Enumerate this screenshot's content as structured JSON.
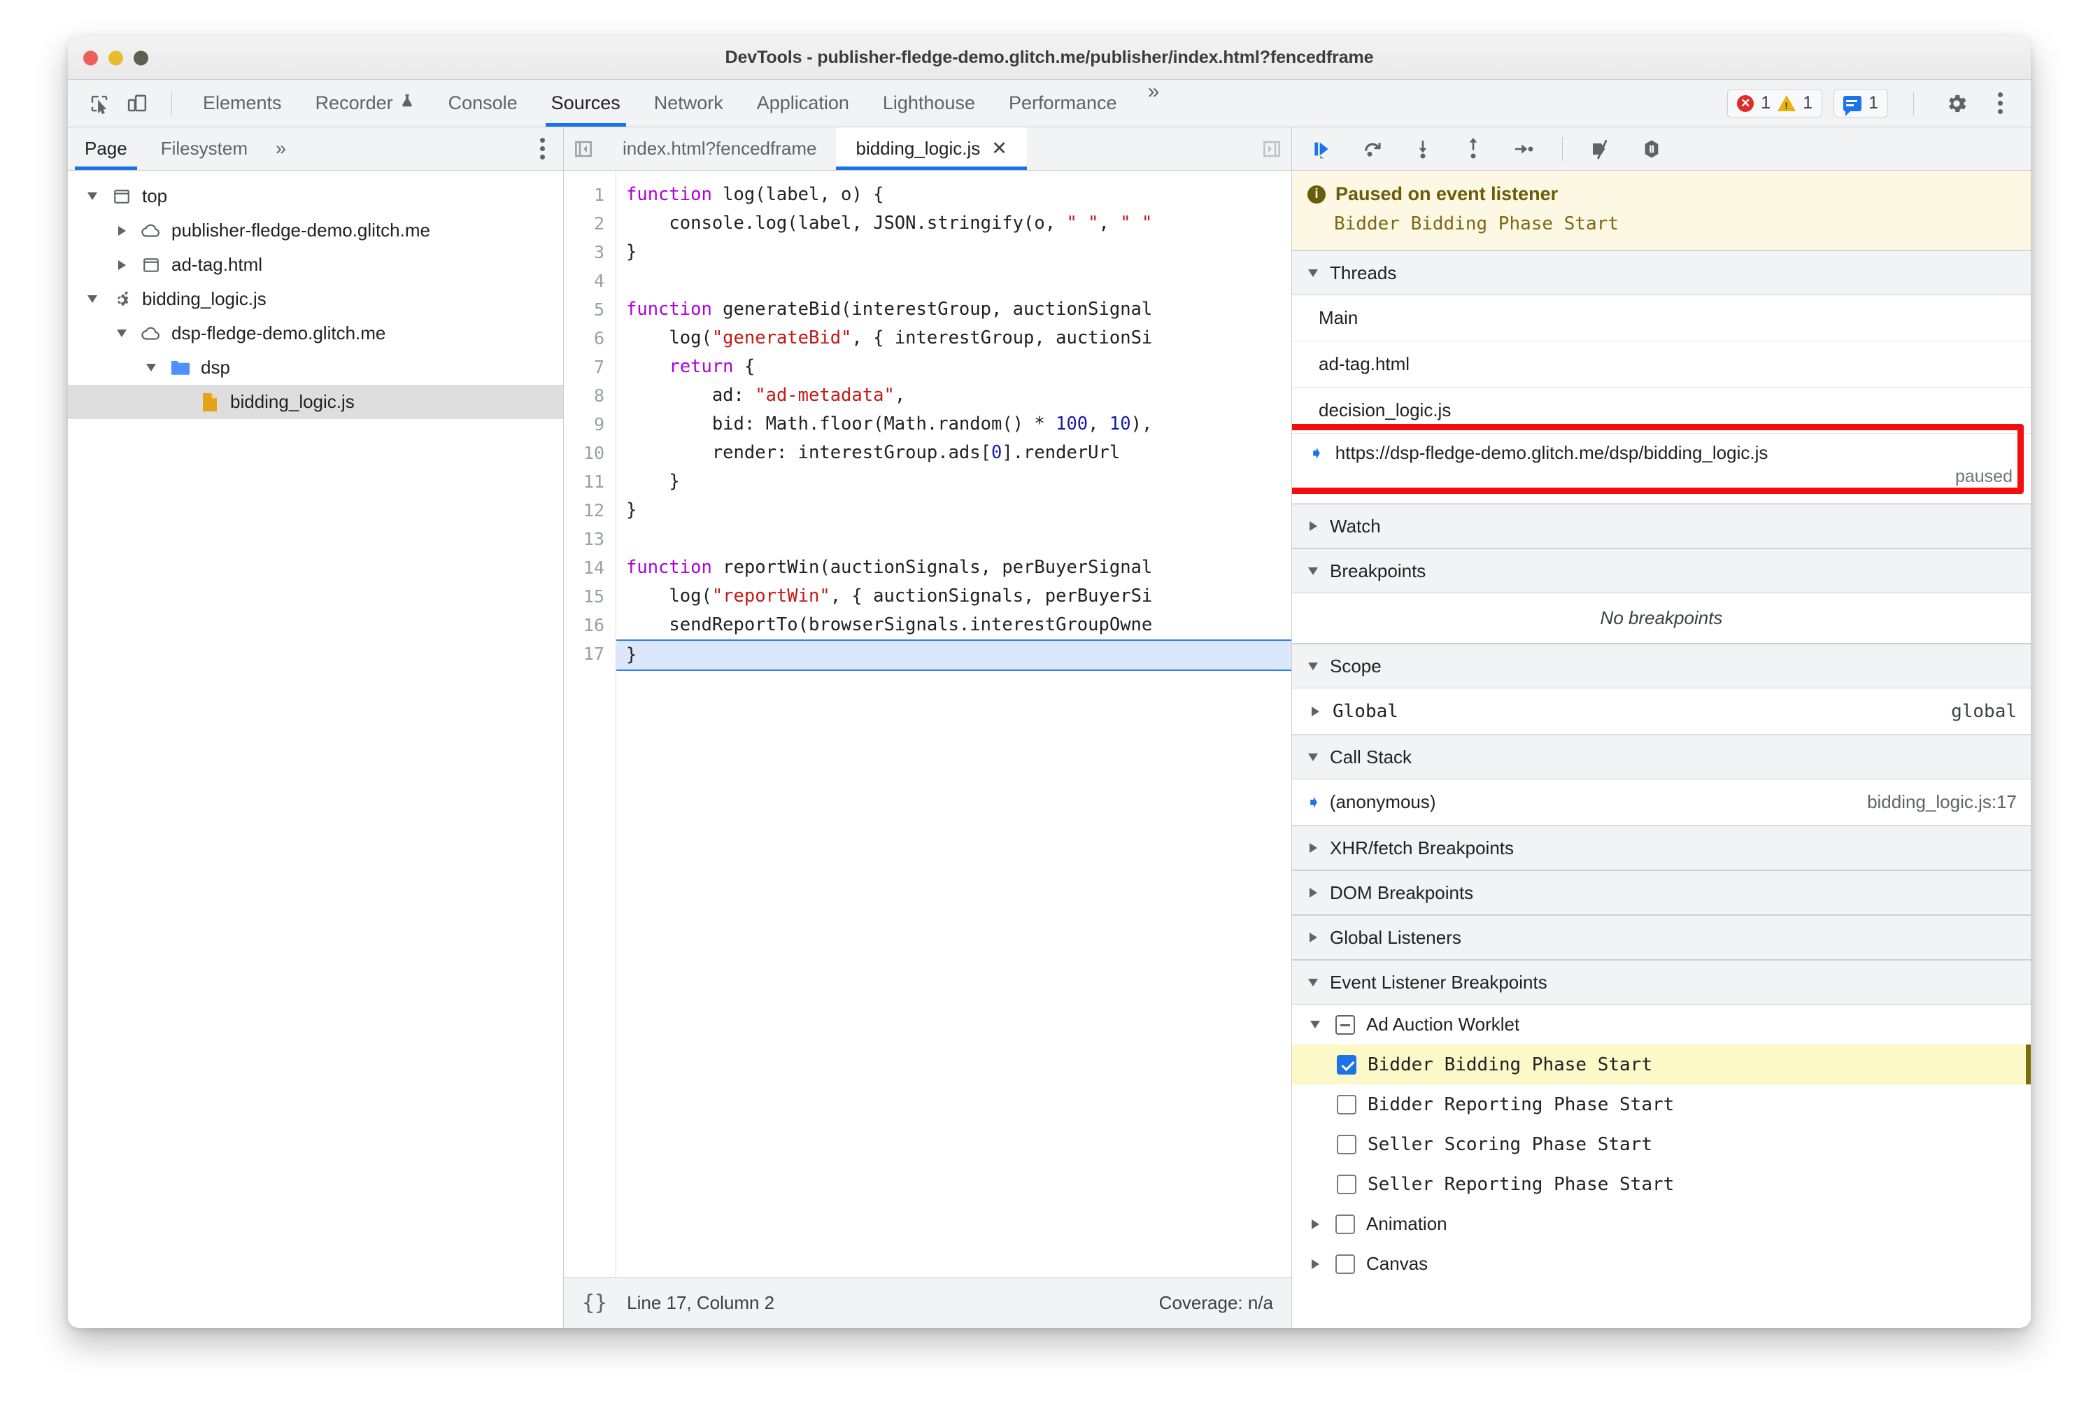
{
  "window": {
    "title": "DevTools - publisher-fledge-demo.glitch.me/publisher/index.html?fencedframe",
    "traffic_lights": [
      "close",
      "minimize",
      "zoom"
    ]
  },
  "toolbar": {
    "icons": [
      "inspect-element-icon",
      "device-toolbar-icon"
    ],
    "tabs": [
      {
        "label": "Elements",
        "active": false
      },
      {
        "label": "Recorder",
        "active": false,
        "badge_icon": "experiment-flask-icon"
      },
      {
        "label": "Console",
        "active": false
      },
      {
        "label": "Sources",
        "active": true
      },
      {
        "label": "Network",
        "active": false
      },
      {
        "label": "Application",
        "active": false
      },
      {
        "label": "Lighthouse",
        "active": false
      },
      {
        "label": "Performance",
        "active": false
      }
    ],
    "more_tabs": "»",
    "error_count": "1",
    "warning_count": "1",
    "message_count": "1",
    "settings_icon": "gear-icon",
    "overflow_icon": "kebab-menu-icon",
    "accent_color": "#1a73e8",
    "error_color": "#dd2c2c",
    "warning_color": "#e9b213"
  },
  "navigator": {
    "tabs": [
      {
        "label": "Page",
        "active": true
      },
      {
        "label": "Filesystem",
        "active": false
      }
    ],
    "more": "»",
    "tree": [
      {
        "label": "top",
        "indent": 0,
        "twisty": "down",
        "icon": "frame-icon",
        "selected": false
      },
      {
        "label": "publisher-fledge-demo.glitch.me",
        "indent": 1,
        "twisty": "right",
        "icon": "cloud-icon",
        "selected": false
      },
      {
        "label": "ad-tag.html",
        "indent": 1,
        "twisty": "right",
        "icon": "frame-icon",
        "selected": false
      },
      {
        "label": "bidding_logic.js",
        "indent": 0,
        "twisty": "down",
        "icon": "worklet-gears-icon",
        "selected": false
      },
      {
        "label": "dsp-fledge-demo.glitch.me",
        "indent": 1,
        "twisty": "down",
        "icon": "cloud-icon",
        "selected": false
      },
      {
        "label": "dsp",
        "indent": 2,
        "twisty": "down",
        "icon": "folder-icon",
        "selected": false
      },
      {
        "label": "bidding_logic.js",
        "indent": 3,
        "twisty": "none",
        "icon": "js-file-icon",
        "selected": true
      }
    ]
  },
  "editor": {
    "tabs": [
      {
        "label": "index.html?fencedframe",
        "active": false,
        "closable": false
      },
      {
        "label": "bidding_logic.js",
        "active": true,
        "closable": true,
        "close_glyph": "✕"
      }
    ],
    "nav_prev_icon": "tab-scroll-left-icon",
    "nav_next_icon": "tab-scroll-right-icon",
    "lines": [
      {
        "n": "1",
        "current": false,
        "tokens": [
          {
            "t": "function ",
            "c": "kw"
          },
          {
            "t": "log(label, o) {",
            "c": ""
          }
        ]
      },
      {
        "n": "2",
        "current": false,
        "tokens": [
          {
            "t": "    console.log(label, JSON.stringify(o, ",
            "c": ""
          },
          {
            "t": "\" \"",
            "c": "str"
          },
          {
            "t": ", ",
            "c": ""
          },
          {
            "t": "\" \"",
            "c": "str"
          }
        ]
      },
      {
        "n": "3",
        "current": false,
        "tokens": [
          {
            "t": "}",
            "c": ""
          }
        ]
      },
      {
        "n": "4",
        "current": false,
        "tokens": [
          {
            "t": "",
            "c": ""
          }
        ]
      },
      {
        "n": "5",
        "current": false,
        "tokens": [
          {
            "t": "function ",
            "c": "kw"
          },
          {
            "t": "generateBid(interestGroup, auctionSignal",
            "c": ""
          }
        ]
      },
      {
        "n": "6",
        "current": false,
        "tokens": [
          {
            "t": "    log(",
            "c": ""
          },
          {
            "t": "\"generateBid\"",
            "c": "str"
          },
          {
            "t": ", { interestGroup, auctionSi",
            "c": ""
          }
        ]
      },
      {
        "n": "7",
        "current": false,
        "tokens": [
          {
            "t": "    ",
            "c": ""
          },
          {
            "t": "return",
            "c": "kw"
          },
          {
            "t": " {",
            "c": ""
          }
        ]
      },
      {
        "n": "8",
        "current": false,
        "tokens": [
          {
            "t": "        ad: ",
            "c": ""
          },
          {
            "t": "\"ad-metadata\"",
            "c": "str"
          },
          {
            "t": ",",
            "c": ""
          }
        ]
      },
      {
        "n": "9",
        "current": false,
        "tokens": [
          {
            "t": "        bid: Math.floor(Math.random() * ",
            "c": ""
          },
          {
            "t": "100",
            "c": "num"
          },
          {
            "t": ", ",
            "c": ""
          },
          {
            "t": "10",
            "c": "num"
          },
          {
            "t": "),",
            "c": ""
          }
        ]
      },
      {
        "n": "10",
        "current": false,
        "tokens": [
          {
            "t": "        render: interestGroup.ads[",
            "c": ""
          },
          {
            "t": "0",
            "c": "num"
          },
          {
            "t": "].renderUrl",
            "c": ""
          }
        ]
      },
      {
        "n": "11",
        "current": false,
        "tokens": [
          {
            "t": "    }",
            "c": ""
          }
        ]
      },
      {
        "n": "12",
        "current": false,
        "tokens": [
          {
            "t": "}",
            "c": ""
          }
        ]
      },
      {
        "n": "13",
        "current": false,
        "tokens": [
          {
            "t": "",
            "c": ""
          }
        ]
      },
      {
        "n": "14",
        "current": false,
        "tokens": [
          {
            "t": "function ",
            "c": "kw"
          },
          {
            "t": "reportWin(auctionSignals, perBuyerSignal",
            "c": ""
          }
        ]
      },
      {
        "n": "15",
        "current": false,
        "tokens": [
          {
            "t": "    log(",
            "c": ""
          },
          {
            "t": "\"reportWin\"",
            "c": "str"
          },
          {
            "t": ", { auctionSignals, perBuyerSi",
            "c": ""
          }
        ]
      },
      {
        "n": "16",
        "current": false,
        "tokens": [
          {
            "t": "    sendReportTo(browserSignals.interestGroupOwne",
            "c": ""
          }
        ]
      },
      {
        "n": "17",
        "current": true,
        "tokens": [
          {
            "t": "}",
            "c": ""
          }
        ]
      }
    ],
    "status": {
      "format_icon": "{}",
      "position": "Line 17, Column 2",
      "coverage": "Coverage: n/a"
    }
  },
  "debugger": {
    "toolbar_icons": [
      "resume-script-execution-icon",
      "step-over-next-function-call-icon",
      "step-into-next-function-call-icon",
      "step-out-of-current-function-icon",
      "step-icon",
      "deactivate-breakpoints-icon",
      "pause-on-exceptions-icon"
    ],
    "paused_banner": {
      "icon": "info-icon",
      "title": "Paused on event listener",
      "subtitle": "Bidder Bidding Phase Start",
      "background": "#fdf8e3"
    },
    "sections": {
      "threads": {
        "label": "Threads",
        "expanded": true,
        "items": [
          {
            "label": "Main",
            "selected": false,
            "status": ""
          },
          {
            "label": "ad-tag.html",
            "selected": false,
            "status": ""
          },
          {
            "label": "decision_logic.js",
            "selected": false,
            "status": ""
          },
          {
            "label": "https://dsp-fledge-demo.glitch.me/dsp/bidding_logic.js",
            "selected": true,
            "status": "paused",
            "highlight_box": true,
            "highlight_color": "#f40d0d"
          }
        ]
      },
      "watch": {
        "label": "Watch",
        "expanded": false
      },
      "breakpoints": {
        "label": "Breakpoints",
        "expanded": true,
        "empty_text": "No breakpoints"
      },
      "scope": {
        "label": "Scope",
        "expanded": true,
        "items": [
          {
            "label": "Global",
            "value": "global"
          }
        ]
      },
      "call_stack": {
        "label": "Call Stack",
        "expanded": true,
        "items": [
          {
            "label": "(anonymous)",
            "location": "bidding_logic.js:17",
            "active": true
          }
        ]
      },
      "xhr_fetch_breakpoints": {
        "label": "XHR/fetch Breakpoints",
        "expanded": false
      },
      "dom_breakpoints": {
        "label": "DOM Breakpoints",
        "expanded": false
      },
      "global_listeners": {
        "label": "Global Listeners",
        "expanded": false
      },
      "event_listener_breakpoints": {
        "label": "Event Listener Breakpoints",
        "expanded": true,
        "groups": [
          {
            "label": "Ad Auction Worklet",
            "expanded": true,
            "checkbox": "indeterminate",
            "children": [
              {
                "label": "Bidder Bidding Phase Start",
                "checked": true,
                "selected": true
              },
              {
                "label": "Bidder Reporting Phase Start",
                "checked": false,
                "selected": false
              },
              {
                "label": "Seller Scoring Phase Start",
                "checked": false,
                "selected": false
              },
              {
                "label": "Seller Reporting Phase Start",
                "checked": false,
                "selected": false
              }
            ]
          },
          {
            "label": "Animation",
            "expanded": false,
            "checkbox": "unchecked",
            "children": []
          },
          {
            "label": "Canvas",
            "expanded": false,
            "checkbox": "unchecked",
            "children": []
          }
        ]
      }
    }
  }
}
